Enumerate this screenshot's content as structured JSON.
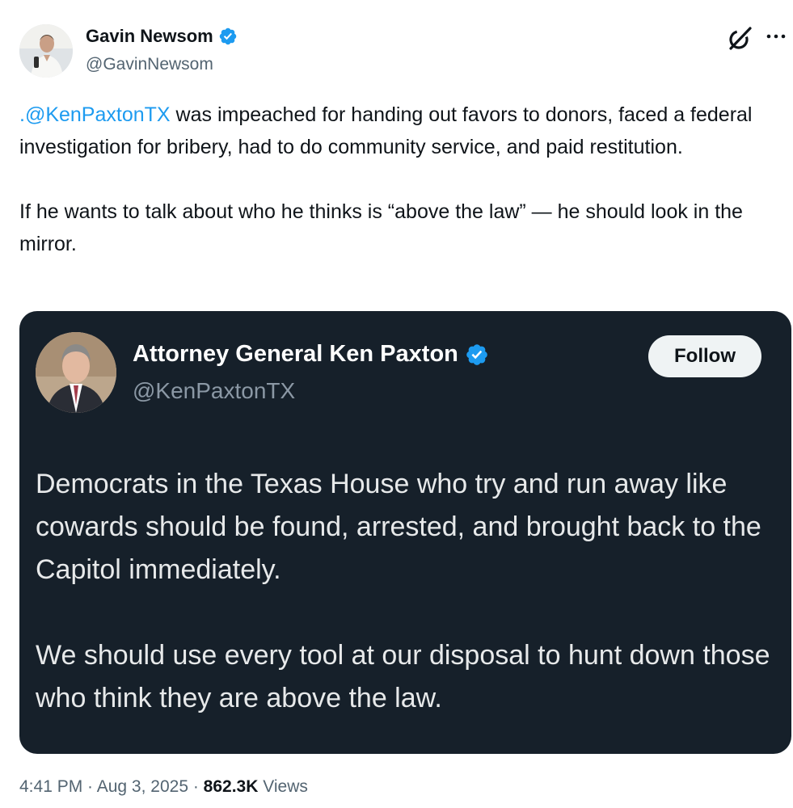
{
  "post": {
    "author": {
      "name": "Gavin Newsom",
      "handle": "@GavinNewsom"
    },
    "text": {
      "mention": ".@KenPaxtonTX",
      "para1_rest": " was impeached for handing out favors to donors, faced a federal investigation for bribery, had to do community service, and paid restitution.",
      "para2": "If he wants to talk about who he thinks is “above the law” — he should look in the mirror."
    },
    "quoted": {
      "name": "Attorney General Ken Paxton",
      "handle": "@KenPaxtonTX",
      "follow_label": "Follow",
      "para1": "Democrats in the Texas House who try and run away like cowards should be found, arrested, and brought back to the Capitol immediately.",
      "para2": "We should use every tool at our disposal to hunt down those who think they are above the law."
    },
    "meta": {
      "time": "4:41 PM",
      "sep1": " · ",
      "date": "Aug 3, 2025",
      "sep2": " · ",
      "views_count": "862.3K",
      "views_label": " Views"
    }
  },
  "icons": {
    "verified": "verified-badge-icon",
    "grok": "grok-icon",
    "more": "more-icon"
  },
  "colors": {
    "link": "#1d9bf0",
    "verified": "#1d9bf0",
    "card_background": "#16202a",
    "secondary_text": "#536471"
  }
}
